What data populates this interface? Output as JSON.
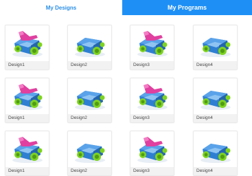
{
  "tabs": {
    "designs_label": "My Designs",
    "programs_label": "My Programs"
  },
  "cards": [
    {
      "label": "Design1",
      "thumbnail": "pink-arm-robot-icon"
    },
    {
      "label": "Design2",
      "thumbnail": "blue-robot-icon"
    },
    {
      "label": "Design3",
      "thumbnail": "pink-arm-robot-icon"
    },
    {
      "label": "Design4",
      "thumbnail": "blue-robot-icon"
    },
    {
      "label": "Design1",
      "thumbnail": "pink-arm-robot-icon"
    },
    {
      "label": "Design2",
      "thumbnail": "blue-robot-icon"
    },
    {
      "label": "Design3",
      "thumbnail": "pink-arm-robot-icon"
    },
    {
      "label": "Design4",
      "thumbnail": "blue-robot-icon"
    },
    {
      "label": "Design1",
      "thumbnail": "pink-arm-robot-icon"
    },
    {
      "label": "Design2",
      "thumbnail": "blue-robot-icon"
    },
    {
      "label": "Design3",
      "thumbnail": "pink-arm-robot-icon"
    },
    {
      "label": "Design4",
      "thumbnail": "blue-robot-icon"
    }
  ],
  "colors": {
    "active_tab_bg": "#1e90f5",
    "inactive_tab_text": "#2b8fe6",
    "robot_body": "#2f7fd1",
    "robot_wheel": "#7ed321",
    "robot_arm": "#e040a0"
  }
}
